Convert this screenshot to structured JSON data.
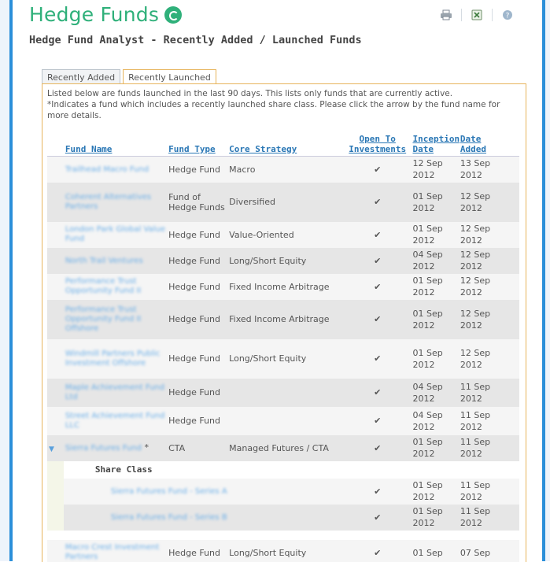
{
  "brand": {
    "name": "Hedge Funds"
  },
  "toolbar": {
    "print_icon": "printer-icon",
    "excel_icon": "excel-icon",
    "help_icon": "help-icon"
  },
  "page": {
    "title": "Hedge Fund Analyst - Recently Added / Launched Funds"
  },
  "tabs": [
    {
      "label": "Recently Added",
      "active": false
    },
    {
      "label": "Recently Launched",
      "active": true
    }
  ],
  "intro": {
    "line1": "Listed below are funds launched in the last 90 days. This lists only funds that are currently active.",
    "line2": "*Indicates a fund which includes a recently launched share class. Please click the arrow by the fund name for more details."
  },
  "table": {
    "headers": {
      "fund_name": "Fund Name",
      "fund_type": "Fund Type",
      "core_strategy": "Core Strategy",
      "open_to_investments": "Open To Investments",
      "inception_date": "Inception Date",
      "date_added": "Date Added"
    },
    "rows": [
      {
        "name": "Trailhead Macro Fund",
        "type": "Hedge Fund",
        "strategy": "Macro",
        "open": "✔",
        "inception": "12 Sep 2012",
        "added": "13 Sep 2012"
      },
      {
        "name": "Coherent Alternatives Partners",
        "type": "Fund of Hedge Funds",
        "strategy": "Diversified",
        "open": "✔",
        "inception": "01 Sep 2012",
        "added": "12 Sep 2012"
      },
      {
        "name": "London Park Global Value Fund",
        "type": "Hedge Fund",
        "strategy": "Value-Oriented",
        "open": "✔",
        "inception": "01 Sep 2012",
        "added": "12 Sep 2012"
      },
      {
        "name": "North Trail Ventures",
        "type": "Hedge Fund",
        "strategy": "Long/Short Equity",
        "open": "✔",
        "inception": "04 Sep 2012",
        "added": "12 Sep 2012"
      },
      {
        "name": "Performance Trust Opportunity Fund II",
        "type": "Hedge Fund",
        "strategy": "Fixed Income Arbitrage",
        "open": "✔",
        "inception": "01 Sep 2012",
        "added": "12 Sep 2012"
      },
      {
        "name": "Performance Trust Opportunity Fund II Offshore",
        "type": "Hedge Fund",
        "strategy": "Fixed Income Arbitrage",
        "open": "✔",
        "inception": "01 Sep 2012",
        "added": "12 Sep 2012"
      },
      {
        "name": "Windmill Partners Public Investment Offshore",
        "type": "Hedge Fund",
        "strategy": "Long/Short Equity",
        "open": "✔",
        "inception": "01 Sep 2012",
        "added": "12 Sep 2012"
      },
      {
        "name": "Maple Achievement Fund Ltd",
        "type": "Hedge Fund",
        "strategy": "",
        "open": "✔",
        "inception": "04 Sep 2012",
        "added": "11 Sep 2012"
      },
      {
        "name": "Street Achievement Fund LLC",
        "type": "Hedge Fund",
        "strategy": "",
        "open": "✔",
        "inception": "04 Sep 2012",
        "added": "11 Sep 2012"
      },
      {
        "name": "Sierra Futures Fund",
        "type": "CTA",
        "strategy": "Managed Futures / CTA",
        "open": "✔",
        "inception": "01 Sep 2012",
        "added": "11 Sep 2012",
        "marker": "*"
      }
    ],
    "share_class": {
      "label": "Share Class",
      "rows": [
        {
          "name": "Sierra Futures Fund - Series A",
          "open": "✔",
          "inception": "01 Sep 2012",
          "added": "11 Sep 2012"
        },
        {
          "name": "Sierra Futures Fund - Series B",
          "open": "✔",
          "inception": "01 Sep 2012",
          "added": "11 Sep 2012"
        }
      ]
    },
    "last_row": {
      "name": "Macro Crest Investment Partners",
      "type": "Hedge Fund",
      "strategy": "Long/Short Equity",
      "open": "✔",
      "inception": "01 Sep",
      "added": "07 Sep"
    }
  }
}
